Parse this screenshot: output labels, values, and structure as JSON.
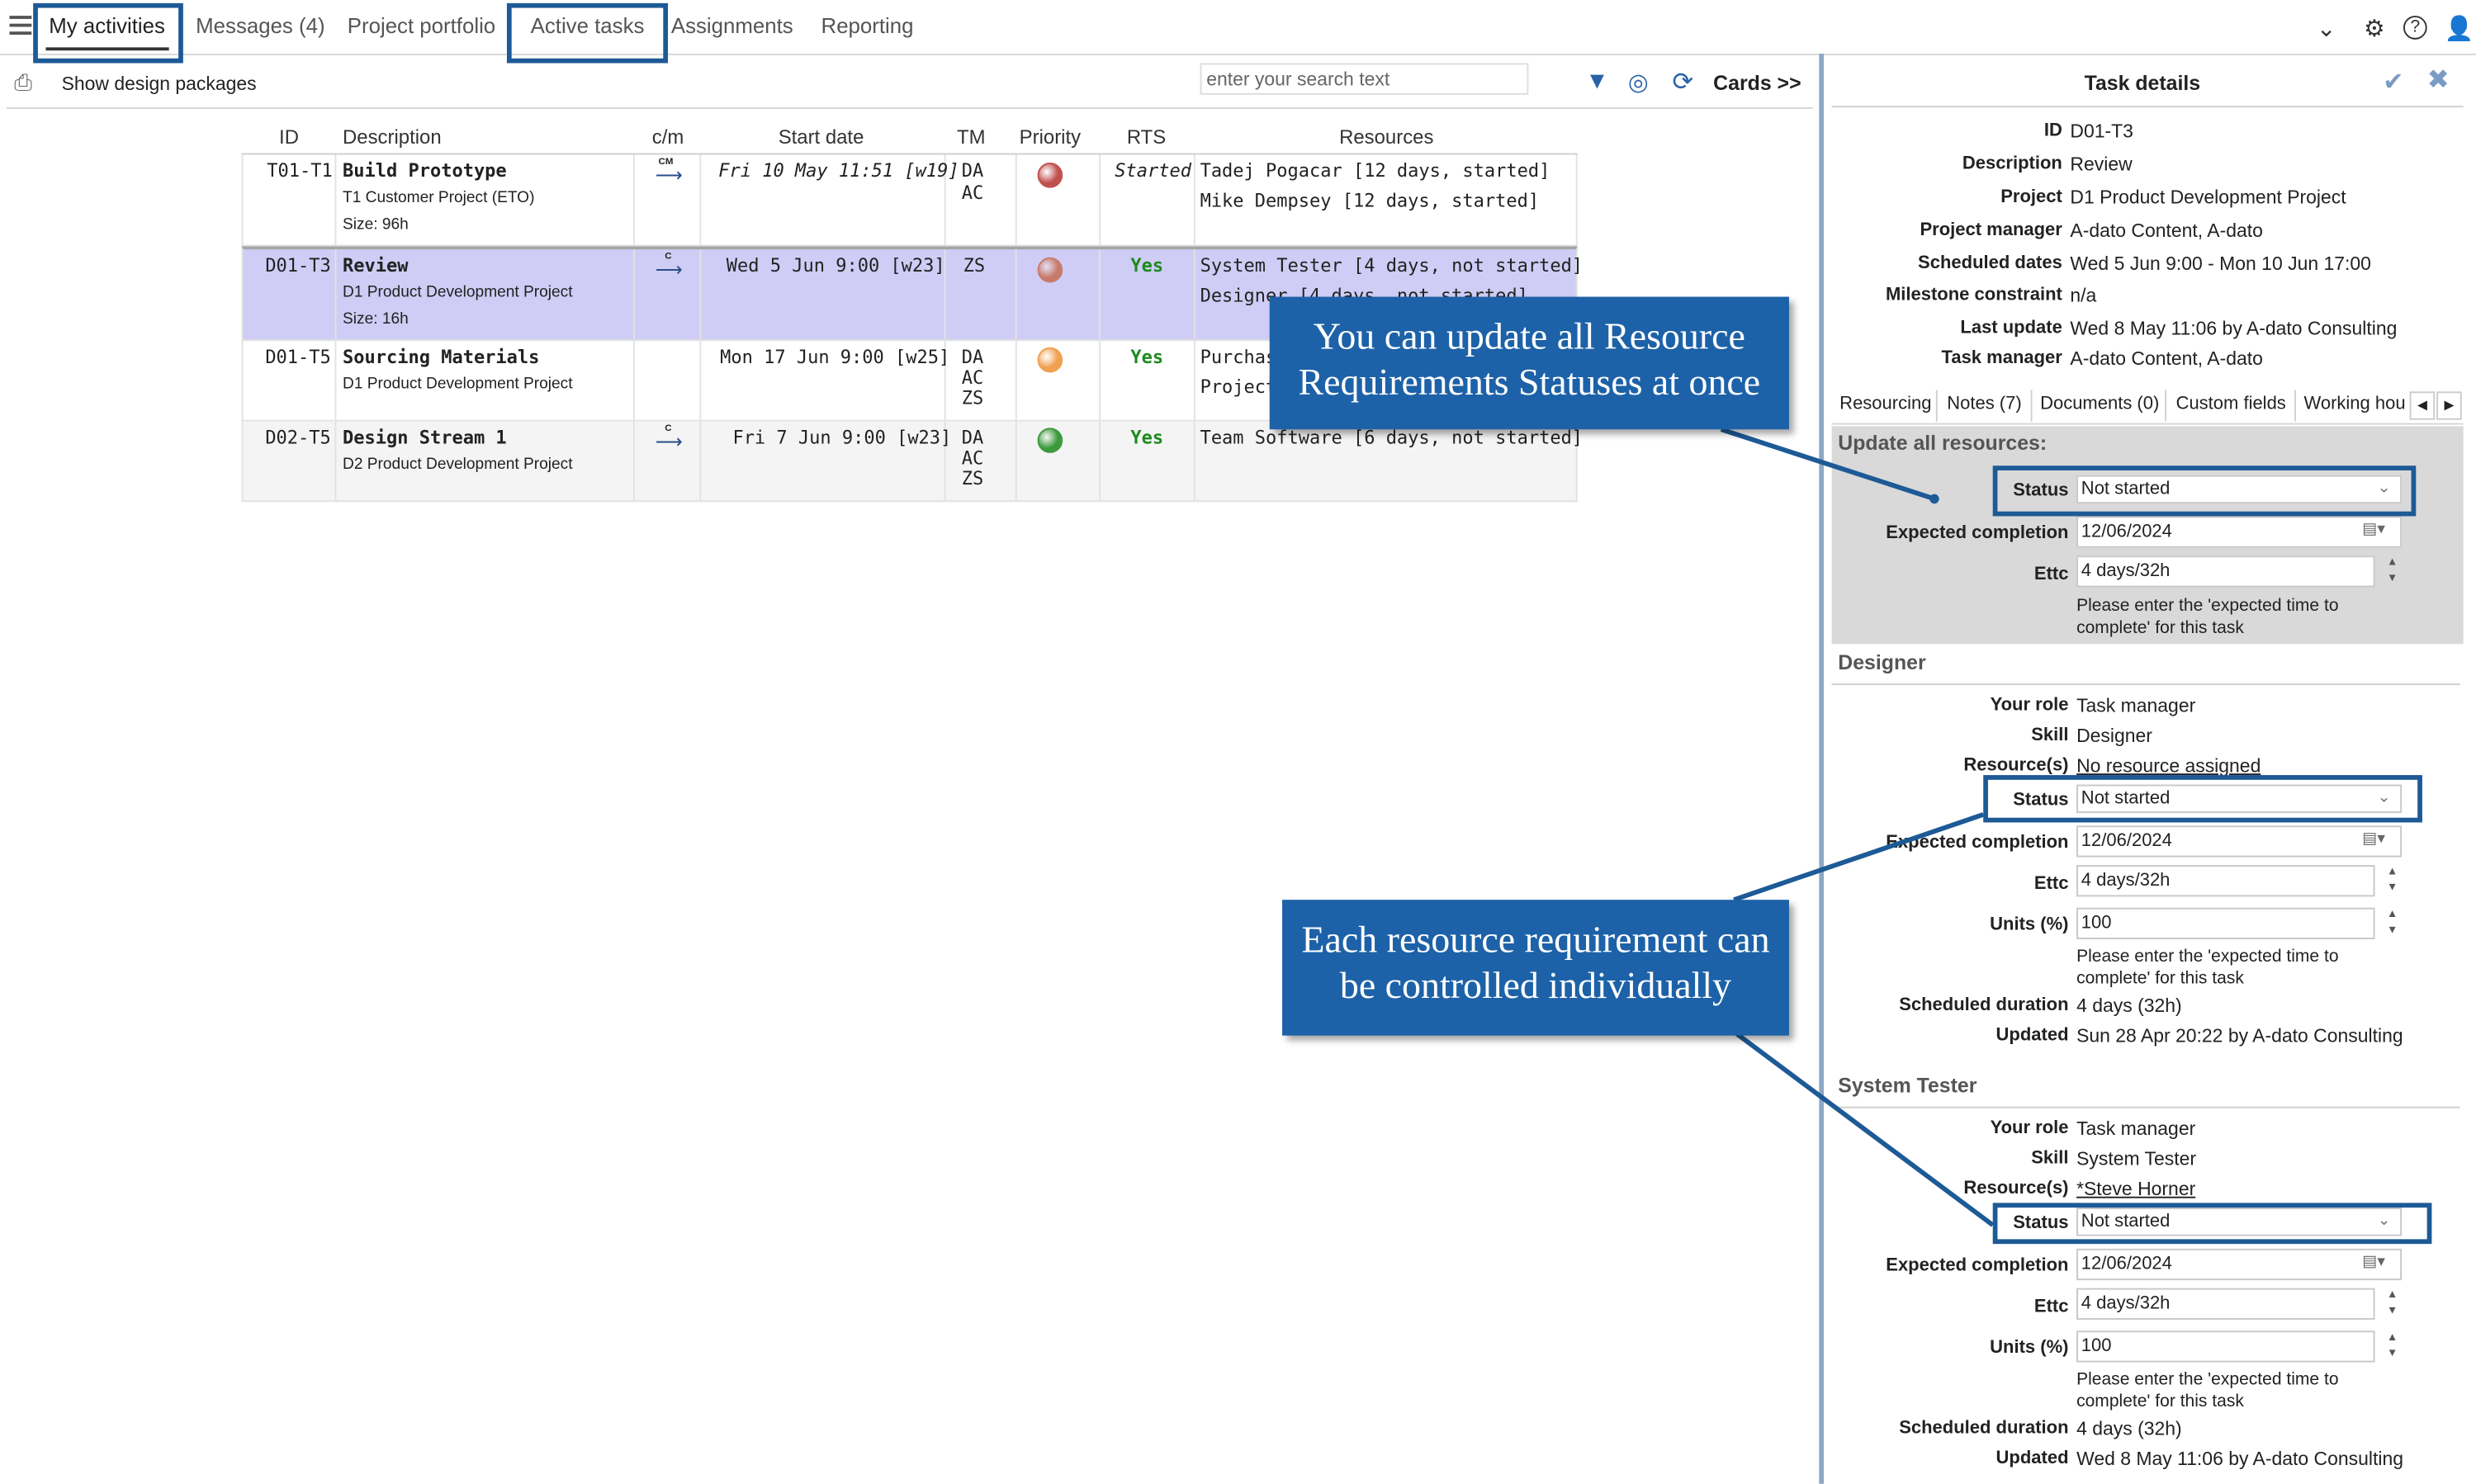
{
  "nav": {
    "tabs": [
      {
        "label": "My activities"
      },
      {
        "label": "Messages (4)"
      },
      {
        "label": "Project portfolio"
      },
      {
        "label": "Active tasks"
      },
      {
        "label": "Assignments"
      },
      {
        "label": "Reporting"
      }
    ]
  },
  "toolbar": {
    "show_design_packages": "Show design packages",
    "search_placeholder": "enter your search text",
    "cards_label": "Cards >>"
  },
  "grid": {
    "headers": [
      "ID",
      "Description",
      "c/m",
      "Start date",
      "TM",
      "Priority",
      "RTS",
      "Resources"
    ],
    "rows": [
      {
        "id": "T01-T1",
        "title": "Build Prototype",
        "project": "T1 Customer Project (ETO)",
        "size": "Size: 96h",
        "cm": "CM",
        "start": "Fri 10 May 11:51 [w19]",
        "tm": [
          "DA",
          "AC"
        ],
        "priority_color": "#c0504d",
        "rts": "Started",
        "resources": [
          "Tadej Pogacar [12 days, started]",
          "Mike Dempsey [12 days, started]"
        ]
      },
      {
        "id": "D01-T3",
        "title": "Review",
        "project": "D1 Product Development Project",
        "size": "Size: 16h",
        "cm": "C",
        "start": "Wed 5 Jun 9:00 [w23]",
        "tm": [
          "ZS"
        ],
        "priority_color": "#c87a6a",
        "rts": "Yes",
        "resources": [
          "System Tester [4 days, not started]",
          "Designer [4 days, not started]"
        ]
      },
      {
        "id": "D01-T5",
        "title": "Sourcing Materials",
        "project": "D1 Product Development Project",
        "size": "",
        "cm": "",
        "start": "Mon 17 Jun 9:00 [w25]",
        "tm": [
          "DA",
          "AC",
          "ZS"
        ],
        "priority_color": "#f0a050",
        "rts": "Yes",
        "resources": [
          "Purchas",
          "Project"
        ]
      },
      {
        "id": "D02-T5",
        "title": "Design Stream 1",
        "project": "D2 Product Development Project",
        "size": "",
        "cm": "C",
        "start": "Fri 7 Jun 9:00 [w23]",
        "tm": [
          "DA",
          "AC",
          "ZS"
        ],
        "priority_color": "#3c9a3c",
        "rts": "Yes",
        "resources": [
          "Team Software [6 days, not started]"
        ]
      }
    ]
  },
  "panel": {
    "title": "Task details",
    "fields": [
      {
        "label": "ID",
        "value": "D01-T3"
      },
      {
        "label": "Description",
        "value": "Review"
      },
      {
        "label": "Project",
        "value": "D1 Product Development Project"
      },
      {
        "label": "Project manager",
        "value": "A-dato Content, A-dato"
      },
      {
        "label": "Scheduled dates",
        "value": "Wed 5 Jun 9:00 - Mon 10 Jun 17:00"
      },
      {
        "label": "Milestone constraint",
        "value": "n/a"
      },
      {
        "label": "Last update",
        "value": "Wed 8 May 11:06 by A-dato Consulting"
      },
      {
        "label": "Task manager",
        "value": "A-dato Content, A-dato"
      }
    ],
    "tabs": [
      "Resourcing",
      "Notes (7)",
      "Documents (0)",
      "Custom fields",
      "Working hou"
    ],
    "update_all": {
      "heading": "Update all resources:",
      "status_label": "Status",
      "status": "Not started",
      "expected_label": "Expected completion",
      "expected": "12/06/2024",
      "ettc_label": "Ettc",
      "ettc": "4 days/32h",
      "note": "Please enter the 'expected time to complete' for this task"
    },
    "designer": {
      "heading": "Designer",
      "role_label": "Your role",
      "role": "Task manager",
      "skill_label": "Skill",
      "skill": "Designer",
      "resources_label": "Resource(s)",
      "resources": "No resource assigned",
      "status_label": "Status",
      "status": "Not started",
      "expected_label": "Expected completion",
      "expected": "12/06/2024",
      "ettc_label": "Ettc",
      "ettc": "4 days/32h",
      "units_label": "Units (%)",
      "units": "100",
      "note": "Please enter the 'expected time to complete' for this task",
      "duration_label": "Scheduled duration",
      "duration": "4 days (32h)",
      "updated_label": "Updated",
      "updated": "Sun 28 Apr 20:22 by A-dato Consulting"
    },
    "tester": {
      "heading": "System Tester",
      "role_label": "Your role",
      "role": "Task manager",
      "skill_label": "Skill",
      "skill": "System Tester",
      "resources_label": "Resource(s)",
      "resources": "*Steve Horner",
      "status_label": "Status",
      "status": "Not started",
      "expected_label": "Expected completion",
      "expected": "12/06/2024",
      "ettc_label": "Ettc",
      "ettc": "4 days/32h",
      "units_label": "Units (%)",
      "units": "100",
      "note": "Please enter the 'expected time to complete' for this task",
      "duration_label": "Scheduled duration",
      "duration": "4 days (32h)",
      "updated_label": "Updated",
      "updated": "Wed 8 May 11:06 by A-dato Consulting"
    }
  },
  "callouts": {
    "top": "You can update all Resource Requirements Statuses at once",
    "bottom": "Each resource requirement can be controlled individually"
  },
  "colors": {
    "highlight": "#1d5a96",
    "callout": "#1d62a8",
    "selected_row": "#cfcdf5",
    "yes": "#1d8a1d"
  }
}
